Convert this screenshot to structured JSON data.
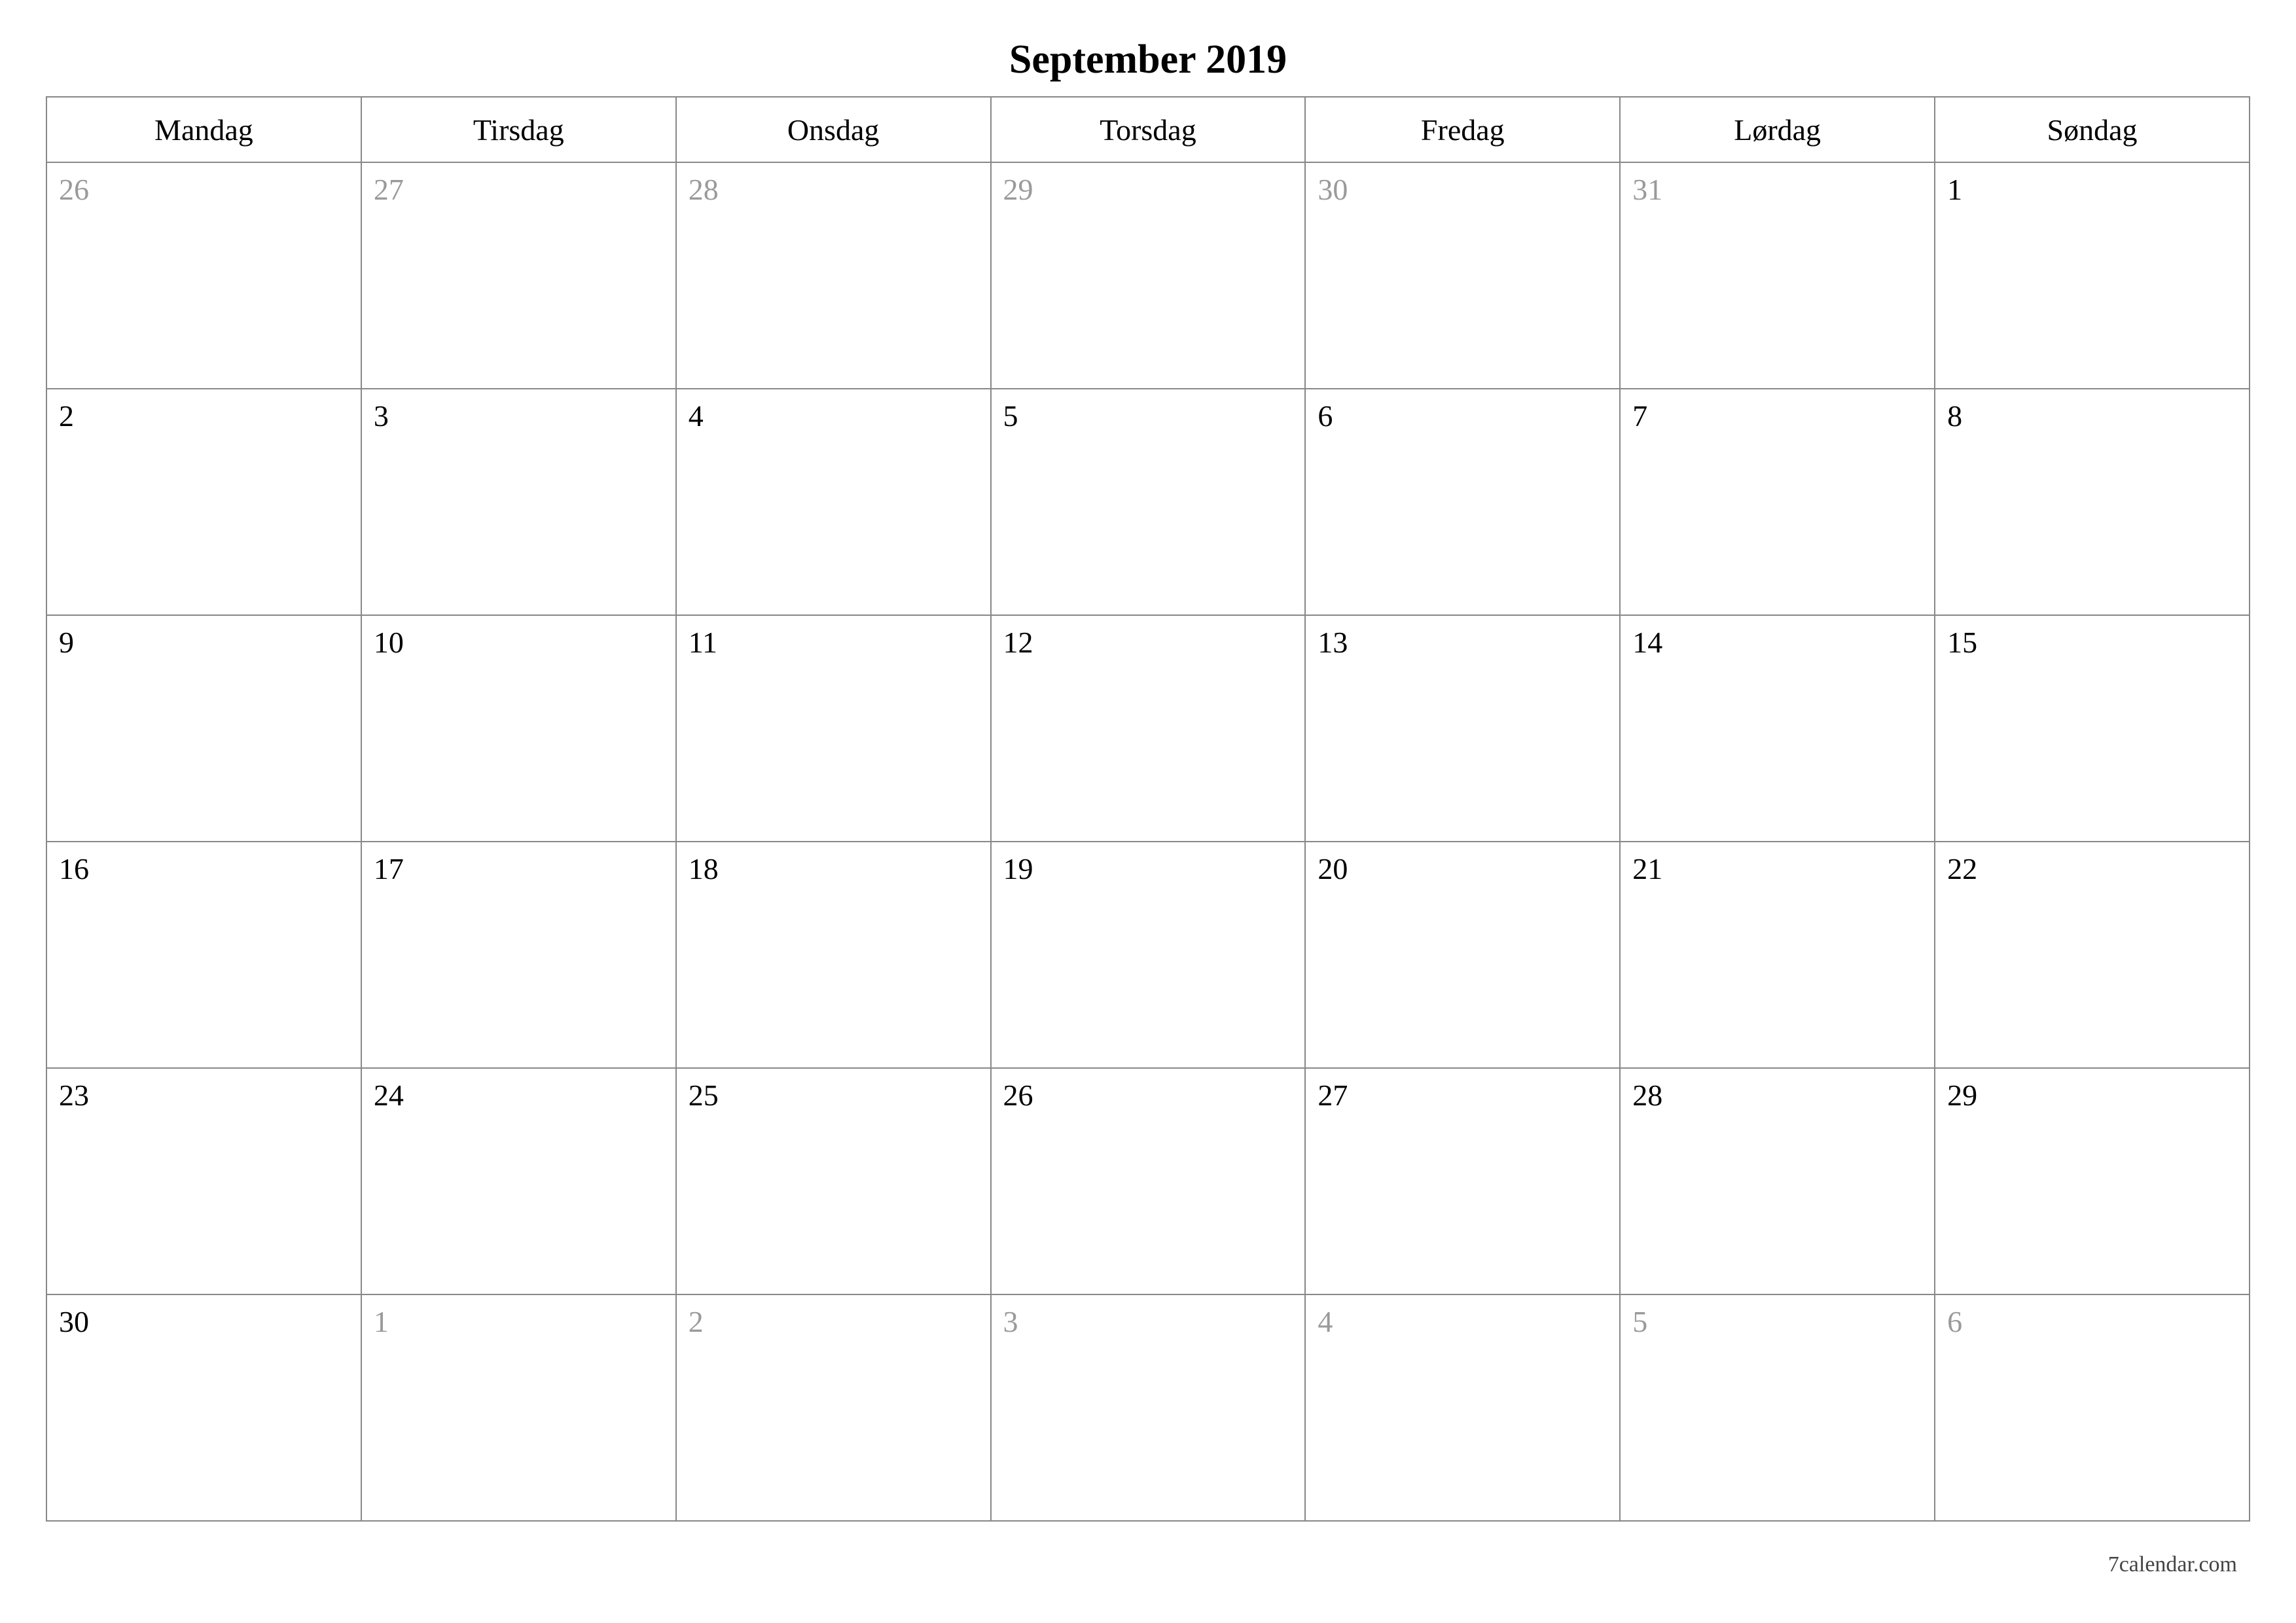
{
  "title": "September 2019",
  "weekdays": [
    "Mandag",
    "Tirsdag",
    "Onsdag",
    "Torsdag",
    "Fredag",
    "Lørdag",
    "Søndag"
  ],
  "weeks": [
    [
      {
        "n": "26",
        "muted": true
      },
      {
        "n": "27",
        "muted": true
      },
      {
        "n": "28",
        "muted": true
      },
      {
        "n": "29",
        "muted": true
      },
      {
        "n": "30",
        "muted": true
      },
      {
        "n": "31",
        "muted": true
      },
      {
        "n": "1",
        "muted": false
      }
    ],
    [
      {
        "n": "2",
        "muted": false
      },
      {
        "n": "3",
        "muted": false
      },
      {
        "n": "4",
        "muted": false
      },
      {
        "n": "5",
        "muted": false
      },
      {
        "n": "6",
        "muted": false
      },
      {
        "n": "7",
        "muted": false
      },
      {
        "n": "8",
        "muted": false
      }
    ],
    [
      {
        "n": "9",
        "muted": false
      },
      {
        "n": "10",
        "muted": false
      },
      {
        "n": "11",
        "muted": false
      },
      {
        "n": "12",
        "muted": false
      },
      {
        "n": "13",
        "muted": false
      },
      {
        "n": "14",
        "muted": false
      },
      {
        "n": "15",
        "muted": false
      }
    ],
    [
      {
        "n": "16",
        "muted": false
      },
      {
        "n": "17",
        "muted": false
      },
      {
        "n": "18",
        "muted": false
      },
      {
        "n": "19",
        "muted": false
      },
      {
        "n": "20",
        "muted": false
      },
      {
        "n": "21",
        "muted": false
      },
      {
        "n": "22",
        "muted": false
      }
    ],
    [
      {
        "n": "23",
        "muted": false
      },
      {
        "n": "24",
        "muted": false
      },
      {
        "n": "25",
        "muted": false
      },
      {
        "n": "26",
        "muted": false
      },
      {
        "n": "27",
        "muted": false
      },
      {
        "n": "28",
        "muted": false
      },
      {
        "n": "29",
        "muted": false
      }
    ],
    [
      {
        "n": "30",
        "muted": false
      },
      {
        "n": "1",
        "muted": true
      },
      {
        "n": "2",
        "muted": true
      },
      {
        "n": "3",
        "muted": true
      },
      {
        "n": "4",
        "muted": true
      },
      {
        "n": "5",
        "muted": true
      },
      {
        "n": "6",
        "muted": true
      }
    ]
  ],
  "footer": "7calendar.com"
}
